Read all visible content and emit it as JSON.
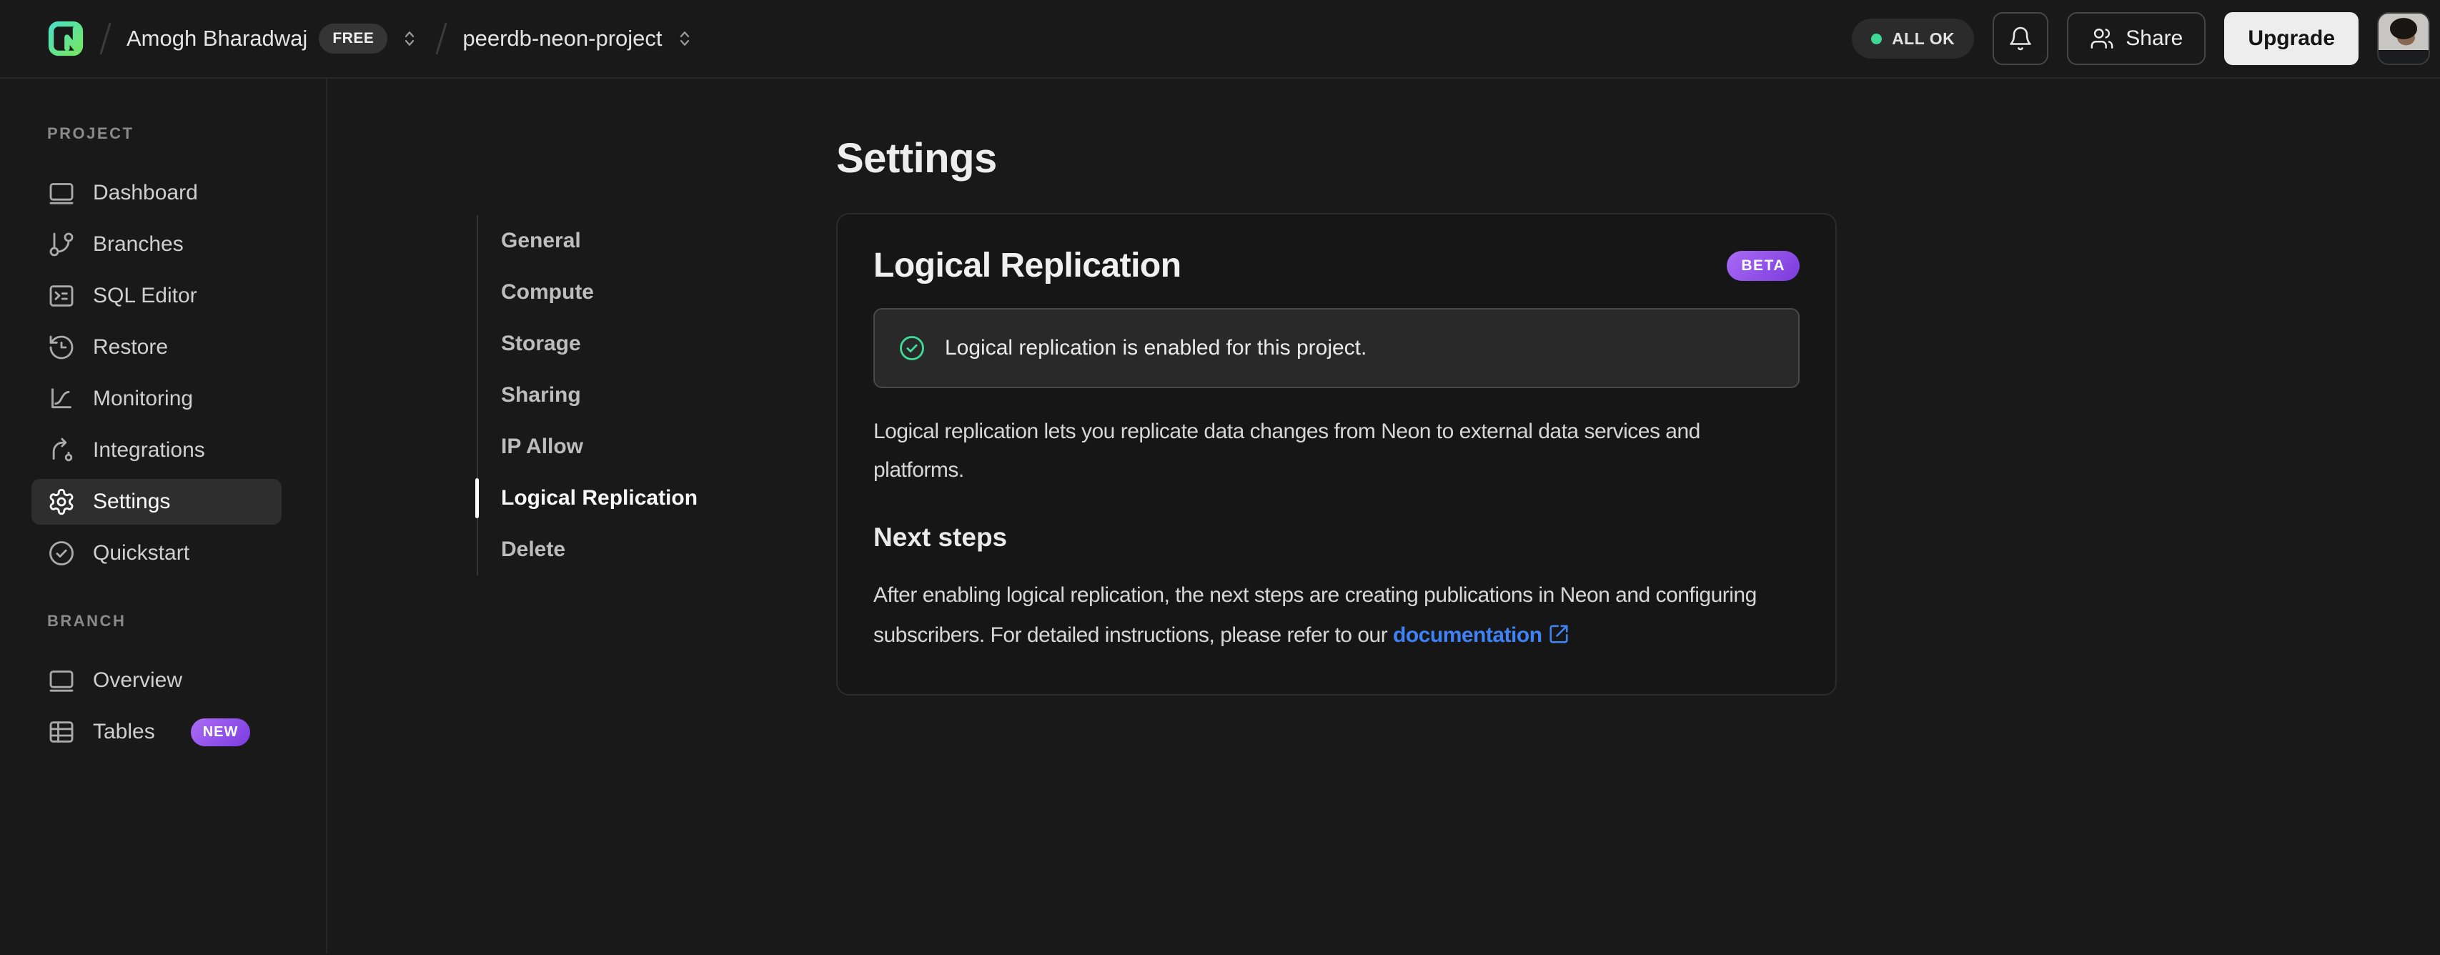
{
  "header": {
    "account": {
      "name": "Amogh Bharadwaj",
      "plan_badge": "FREE"
    },
    "project": {
      "name": "peerdb-neon-project"
    },
    "status_badge": "ALL OK",
    "share_label": "Share",
    "upgrade_label": "Upgrade"
  },
  "sidebar": {
    "project_section": {
      "title": "PROJECT",
      "items": [
        {
          "label": "Dashboard",
          "icon": "dashboard-icon"
        },
        {
          "label": "Branches",
          "icon": "branches-icon"
        },
        {
          "label": "SQL Editor",
          "icon": "sql-editor-icon"
        },
        {
          "label": "Restore",
          "icon": "restore-icon"
        },
        {
          "label": "Monitoring",
          "icon": "monitoring-icon"
        },
        {
          "label": "Integrations",
          "icon": "integrations-icon"
        },
        {
          "label": "Settings",
          "icon": "gear-icon",
          "active": true
        },
        {
          "label": "Quickstart",
          "icon": "check-circle-icon"
        }
      ]
    },
    "branch_section": {
      "title": "BRANCH",
      "items": [
        {
          "label": "Overview",
          "icon": "overview-icon"
        },
        {
          "label": "Tables",
          "icon": "table-icon",
          "badge": "NEW"
        }
      ]
    }
  },
  "settings_nav": {
    "items": [
      {
        "label": "General"
      },
      {
        "label": "Compute"
      },
      {
        "label": "Storage"
      },
      {
        "label": "Sharing"
      },
      {
        "label": "IP Allow"
      },
      {
        "label": "Logical Replication",
        "active": true
      },
      {
        "label": "Delete"
      }
    ]
  },
  "main": {
    "page_title": "Settings",
    "card": {
      "title": "Logical Replication",
      "badge": "BETA",
      "alert_text": "Logical replication is enabled for this project.",
      "description": "Logical replication lets you replicate data changes from Neon to external data services and platforms.",
      "next_steps_title": "Next steps",
      "next_steps_text_before": "After enabling logical replication, the next steps are creating publications in Neon and configuring subscribers. For detailed instructions, please refer to our ",
      "doc_link_label": "documentation"
    }
  },
  "colors": {
    "status_green": "#3fd794",
    "check_green": "#3edc97",
    "link_blue": "#3e82f6",
    "badge_purple_start": "#ab6cf5",
    "badge_purple_end": "#7c3ce0",
    "logo_gradient_start": "#4ee0c1",
    "logo_gradient_end": "#74e663"
  }
}
